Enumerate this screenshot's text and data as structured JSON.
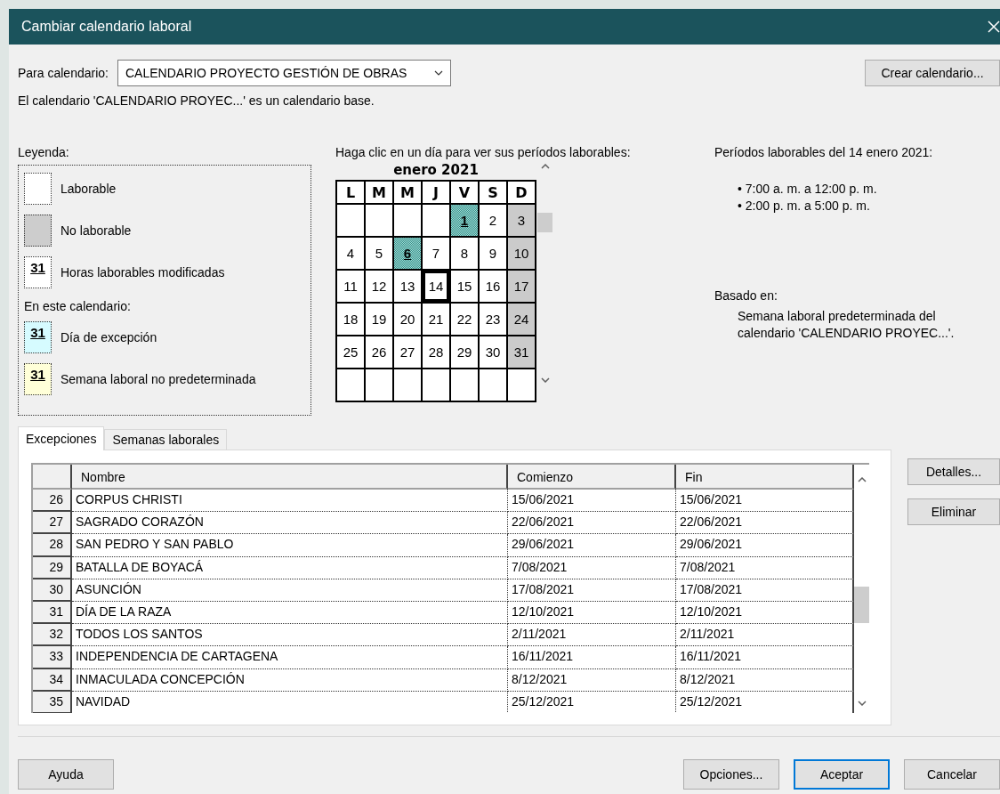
{
  "window": {
    "title": "Cambiar calendario laboral"
  },
  "calendar_selector": {
    "label": "Para calendario:",
    "value": "CALENDARIO PROYECTO GESTIÓN DE OBRAS",
    "button": "Crear calendario..."
  },
  "description": "El calendario 'CALENDARIO PROYEC...' es un calendario base.",
  "legend": {
    "title": "Leyenda:",
    "items": [
      {
        "kind": "working",
        "label": "Laborable"
      },
      {
        "kind": "nonworking",
        "label": "No laborable"
      },
      {
        "kind": "modified",
        "sample": "31",
        "label": "Horas laborables modificadas"
      }
    ],
    "section_label": "En este calendario:",
    "section_items": [
      {
        "kind": "exception",
        "sample": "31",
        "label": "Día de excepción"
      },
      {
        "kind": "nondefault_week",
        "sample": "31",
        "label": "Semana laboral no predeterminada"
      }
    ]
  },
  "calendar": {
    "instruction": "Haga clic en un día para ver sus períodos laborables:",
    "month": "enero 2021",
    "weekdays": [
      "L",
      "M",
      "M",
      "J",
      "V",
      "S",
      "D"
    ],
    "weeks": [
      [
        {
          "kind": "blank"
        },
        {
          "kind": "blank"
        },
        {
          "kind": "blank"
        },
        {
          "kind": "blank"
        },
        {
          "day": "1",
          "kind": "exception",
          "selected": false
        },
        {
          "day": "2",
          "kind": "working",
          "selected": false
        },
        {
          "day": "3",
          "kind": "nonworking",
          "selected": false
        }
      ],
      [
        {
          "day": "4",
          "kind": "working",
          "selected": false
        },
        {
          "day": "5",
          "kind": "working",
          "selected": false
        },
        {
          "day": "6",
          "kind": "exception",
          "selected": false
        },
        {
          "day": "7",
          "kind": "working",
          "selected": false
        },
        {
          "day": "8",
          "kind": "working",
          "selected": false
        },
        {
          "day": "9",
          "kind": "working",
          "selected": false
        },
        {
          "day": "10",
          "kind": "nonworking",
          "selected": false
        }
      ],
      [
        {
          "day": "11",
          "kind": "working",
          "selected": false
        },
        {
          "day": "12",
          "kind": "working",
          "selected": false
        },
        {
          "day": "13",
          "kind": "working",
          "selected": false
        },
        {
          "day": "14",
          "kind": "working",
          "selected": true
        },
        {
          "day": "15",
          "kind": "working",
          "selected": false
        },
        {
          "day": "16",
          "kind": "working",
          "selected": false
        },
        {
          "day": "17",
          "kind": "nonworking",
          "selected": false
        }
      ],
      [
        {
          "day": "18",
          "kind": "working",
          "selected": false
        },
        {
          "day": "19",
          "kind": "working",
          "selected": false
        },
        {
          "day": "20",
          "kind": "working",
          "selected": false
        },
        {
          "day": "21",
          "kind": "working",
          "selected": false
        },
        {
          "day": "22",
          "kind": "working",
          "selected": false
        },
        {
          "day": "23",
          "kind": "working",
          "selected": false
        },
        {
          "day": "24",
          "kind": "nonworking",
          "selected": false
        }
      ],
      [
        {
          "day": "25",
          "kind": "working",
          "selected": false
        },
        {
          "day": "26",
          "kind": "working",
          "selected": false
        },
        {
          "day": "27",
          "kind": "working",
          "selected": false
        },
        {
          "day": "28",
          "kind": "working",
          "selected": false
        },
        {
          "day": "29",
          "kind": "working",
          "selected": false
        },
        {
          "day": "30",
          "kind": "working",
          "selected": false
        },
        {
          "day": "31",
          "kind": "nonworking",
          "selected": false
        }
      ],
      [
        {
          "kind": "blank"
        },
        {
          "kind": "blank"
        },
        {
          "kind": "blank"
        },
        {
          "kind": "blank"
        },
        {
          "kind": "blank"
        },
        {
          "kind": "blank"
        },
        {
          "kind": "blank"
        }
      ]
    ]
  },
  "working_times": {
    "title": "Períodos laborables del 14 enero 2021:",
    "periods": [
      "• 7:00 a. m. a 12:00 p. m.",
      "• 2:00 p. m. a 5:00 p. m."
    ],
    "based_on_label": "Basado en:",
    "based_on": "Semana laboral predeterminada del calendario 'CALENDARIO PROYEC...'."
  },
  "tabs": [
    {
      "label": "Excepciones",
      "selected": true
    },
    {
      "label": "Semanas laborales",
      "selected": false
    }
  ],
  "exceptions_table": {
    "columns": [
      "Nombre",
      "Comienzo",
      "Fin"
    ],
    "rows": [
      {
        "id": "26",
        "name": "CORPUS CHRISTI",
        "start": "15/06/2021",
        "finish": "15/06/2021"
      },
      {
        "id": "27",
        "name": "SAGRADO CORAZÓN",
        "start": "22/06/2021",
        "finish": "22/06/2021"
      },
      {
        "id": "28",
        "name": "SAN PEDRO Y SAN PABLO",
        "start": "29/06/2021",
        "finish": "29/06/2021"
      },
      {
        "id": "29",
        "name": "BATALLA DE BOYACÁ",
        "start": "7/08/2021",
        "finish": "7/08/2021"
      },
      {
        "id": "30",
        "name": "ASUNCIÓN",
        "start": "17/08/2021",
        "finish": "17/08/2021"
      },
      {
        "id": "31",
        "name": "DÍA DE LA RAZA",
        "start": "12/10/2021",
        "finish": "12/10/2021"
      },
      {
        "id": "32",
        "name": "TODOS LOS SANTOS",
        "start": "2/11/2021",
        "finish": "2/11/2021"
      },
      {
        "id": "33",
        "name": "INDEPENDENCIA DE CARTAGENA",
        "start": "16/11/2021",
        "finish": "16/11/2021"
      },
      {
        "id": "34",
        "name": "INMACULADA CONCEPCIÓN",
        "start": "8/12/2021",
        "finish": "8/12/2021"
      },
      {
        "id": "35",
        "name": "NAVIDAD",
        "start": "25/12/2021",
        "finish": "25/12/2021"
      }
    ]
  },
  "side_buttons": [
    "Detalles...",
    "Eliminar"
  ],
  "footer_buttons": [
    {
      "label": "Ayuda",
      "default": false
    },
    {
      "label": "Opciones...",
      "default": false
    },
    {
      "label": "Aceptar",
      "default": true
    },
    {
      "label": "Cancelar",
      "default": false
    }
  ]
}
